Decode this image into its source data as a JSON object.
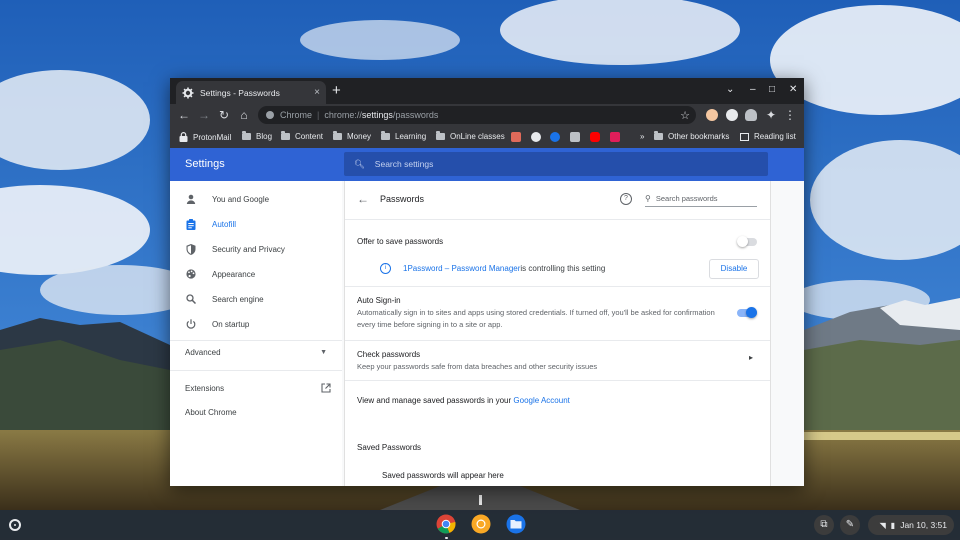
{
  "browser": {
    "tab_title": "Settings - Passwords",
    "tab_close": "×",
    "new_tab": "+",
    "window_controls": [
      "⌄",
      "–",
      "□",
      "✕"
    ],
    "omnibox": {
      "scheme_label": "Chrome",
      "url_prefix": "chrome://",
      "url_host": "settings",
      "url_path": "/passwords"
    },
    "bookmarks": [
      {
        "label": "ProtonMail",
        "icon": "lock-icon"
      },
      {
        "label": "Blog",
        "icon": "folder-icon"
      },
      {
        "label": "Content",
        "icon": "folder-icon"
      },
      {
        "label": "Money",
        "icon": "folder-icon"
      },
      {
        "label": "Learning",
        "icon": "folder-icon"
      },
      {
        "label": "OnLine classes",
        "icon": "folder-icon"
      }
    ],
    "bookmarks_overflow": "»",
    "other_bookmarks": "Other bookmarks",
    "reading_list": "Reading list"
  },
  "settings": {
    "title": "Settings",
    "search_placeholder": "Search settings",
    "sidebar": {
      "items": [
        {
          "label": "You and Google",
          "icon": "person-icon"
        },
        {
          "label": "Autofill",
          "icon": "clipboard-icon",
          "active": true
        },
        {
          "label": "Security and Privacy",
          "icon": "shield-icon"
        },
        {
          "label": "Appearance",
          "icon": "palette-icon"
        },
        {
          "label": "Search engine",
          "icon": "search-icon"
        },
        {
          "label": "On startup",
          "icon": "power-icon"
        }
      ],
      "advanced": "Advanced",
      "extensions": "Extensions",
      "about": "About Chrome"
    },
    "passwords": {
      "heading": "Passwords",
      "search_placeholder": "Search passwords",
      "offer_to_save": "Offer to save passwords",
      "offer_to_save_enabled": false,
      "controller_link": "1Password – Password Manager",
      "controller_text": " is controlling this setting",
      "disable_button": "Disable",
      "auto_signin_title": "Auto Sign-in",
      "auto_signin_desc": "Automatically sign in to sites and apps using stored credentials. If turned off, you'll be asked for confirmation every time before signing in to a site or app.",
      "auto_signin_enabled": true,
      "check_title": "Check passwords",
      "check_desc": "Keep your passwords safe from data breaches and other security issues",
      "manage_text": "View and manage saved passwords in your ",
      "manage_link": "Google Account",
      "saved_heading": "Saved Passwords",
      "saved_empty": "Saved passwords will appear here"
    }
  },
  "shelf": {
    "apps": [
      "chrome-icon",
      "chrome-canary-icon",
      "files-icon"
    ],
    "date_time": "Jan 10, 3:51"
  },
  "colors": {
    "accent": "#1a73e8",
    "settings_header": "#2f63d4"
  }
}
